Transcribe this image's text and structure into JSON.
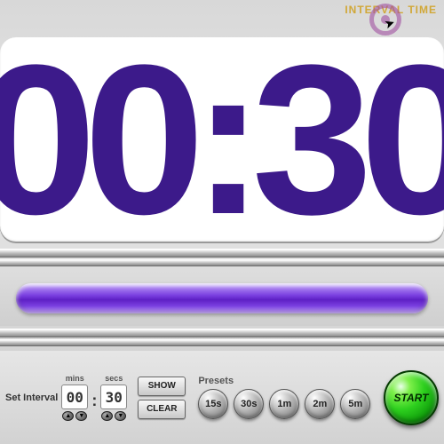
{
  "header": {
    "label": "INTERVAL TIME"
  },
  "display": {
    "time": "00:30"
  },
  "interval": {
    "caption": "Set Interval",
    "mins_label": "mins",
    "secs_label": "secs",
    "mins": "00",
    "secs": "30"
  },
  "buttons": {
    "show": "SHOW",
    "clear": "CLEAR"
  },
  "presets": {
    "label": "Presets",
    "items": [
      "15s",
      "30s",
      "1m",
      "2m",
      "5m"
    ]
  },
  "start": {
    "label": "START"
  },
  "colors": {
    "accent": "#3c1a8a",
    "start": "#1fbf12"
  }
}
